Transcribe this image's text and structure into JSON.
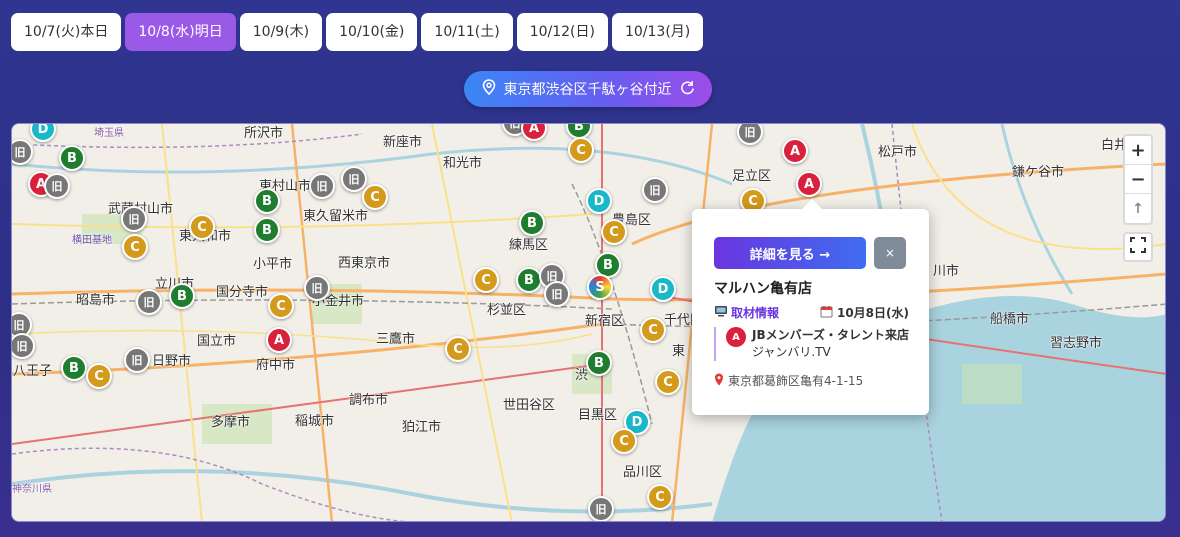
{
  "date_tabs": [
    {
      "label": "10/7(火)本日",
      "active": false
    },
    {
      "label": "10/8(水)明日",
      "active": true
    },
    {
      "label": "10/9(木)",
      "active": false
    },
    {
      "label": "10/10(金)",
      "active": false
    },
    {
      "label": "10/11(土)",
      "active": false
    },
    {
      "label": "10/12(日)",
      "active": false
    },
    {
      "label": "10/13(月)",
      "active": false
    }
  ],
  "location_button": {
    "label": "東京都渋谷区千駄ヶ谷付近",
    "icon_left": "map-pin-icon",
    "icon_right": "refresh-icon"
  },
  "map": {
    "zoom_in": "+",
    "zoom_out": "−",
    "compass": "↑",
    "place_names": [
      "所沢市",
      "新座市",
      "和光市",
      "東村山市",
      "東久留米市",
      "武蔵村山市",
      "東大和市",
      "小平市",
      "西東京市",
      "練馬区",
      "豊島区",
      "立川市",
      "国分寺市",
      "小金井市",
      "杉並区",
      "新宿区",
      "昭島市",
      "国立市",
      "府中市",
      "三鷹市",
      "八王子",
      "日野市",
      "調布市",
      "多摩市",
      "稲城市",
      "狛江市",
      "世田谷区",
      "目黒区",
      "品川区",
      "足立区",
      "松戸市",
      "鎌ケ谷市",
      "白井",
      "川市",
      "船橋市",
      "習志野市",
      "千代田",
      "東",
      "渋",
      "横田基地",
      "埼玉県",
      "神奈川県"
    ],
    "marker_legend": {
      "A": "A",
      "B": "B",
      "C": "C",
      "D": "D",
      "old": "旧",
      "S": "S"
    }
  },
  "popup": {
    "details_button": "詳細を見る →",
    "close_button": "×",
    "shop_name": "マルハン亀有店",
    "coverage_label": "取材情報",
    "coverage_icon": "tv-icon",
    "date_label": "10月8日(水)",
    "date_icon": "calendar-icon",
    "event_rank": "A",
    "event_title": "JBメンバーズ・タレント来店",
    "event_subtitle": "ジャンバリ.TV",
    "address": "東京都葛飾区亀有4-1-15",
    "address_icon": "map-pin-icon"
  },
  "colors": {
    "A": "#d9213b",
    "B": "#1e7d2e",
    "C": "#d39a1c",
    "D": "#19b7c8",
    "old": "#777777",
    "accent": "#9b59e8"
  }
}
